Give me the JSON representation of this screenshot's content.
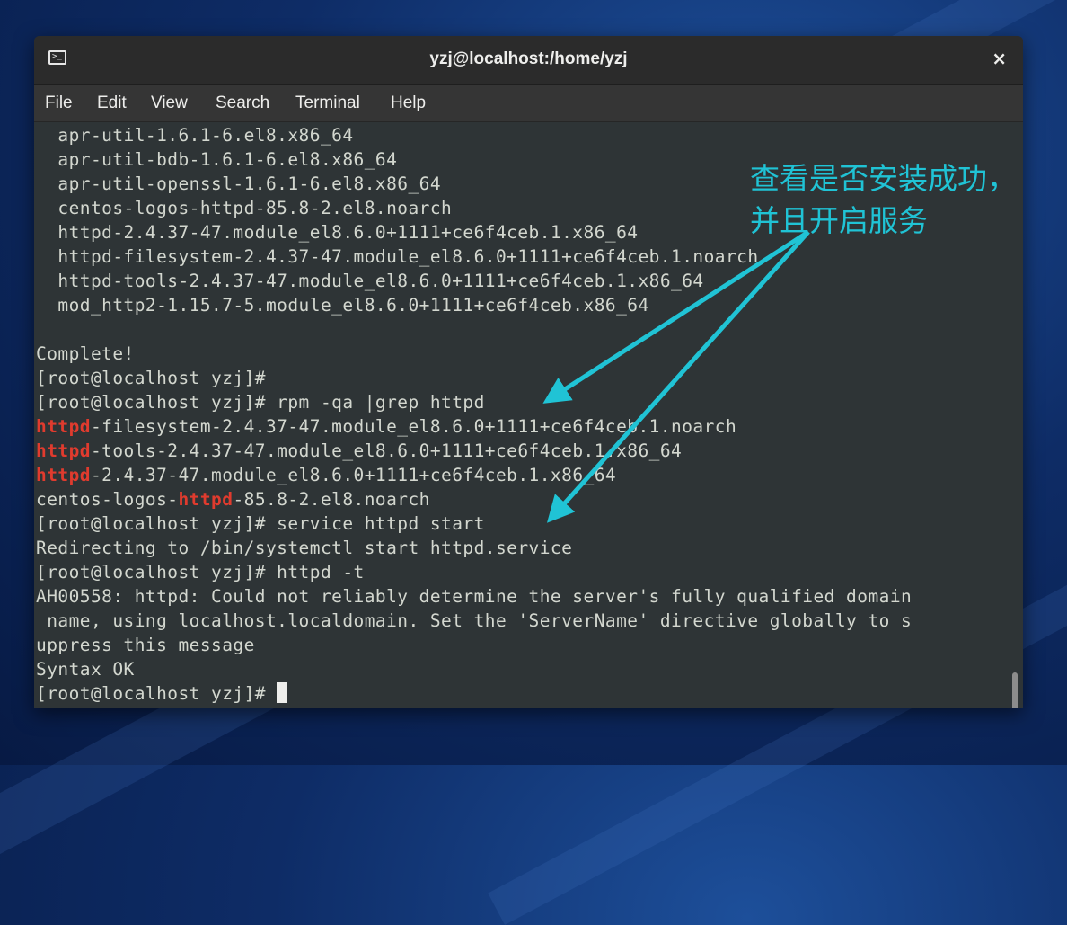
{
  "window": {
    "title": "yzj@localhost:/home/yzj",
    "close_glyph": "×",
    "icon": "terminal-icon"
  },
  "menu": [
    "File",
    "Edit",
    "View",
    "Search",
    "Terminal",
    "Help"
  ],
  "terminal": {
    "lines": [
      [
        {
          "t": "  apr-util-1.6.1-6.el8.x86_64"
        }
      ],
      [
        {
          "t": "  apr-util-bdb-1.6.1-6.el8.x86_64"
        }
      ],
      [
        {
          "t": "  apr-util-openssl-1.6.1-6.el8.x86_64"
        }
      ],
      [
        {
          "t": "  centos-logos-httpd-85.8-2.el8.noarch"
        }
      ],
      [
        {
          "t": "  httpd-2.4.37-47.module_el8.6.0+1111+ce6f4ceb.1.x86_64"
        }
      ],
      [
        {
          "t": "  httpd-filesystem-2.4.37-47.module_el8.6.0+1111+ce6f4ceb.1.noarch"
        }
      ],
      [
        {
          "t": "  httpd-tools-2.4.37-47.module_el8.6.0+1111+ce6f4ceb.1.x86_64"
        }
      ],
      [
        {
          "t": "  mod_http2-1.15.7-5.module_el8.6.0+1111+ce6f4ceb.x86_64"
        }
      ],
      [
        {
          "t": ""
        }
      ],
      [
        {
          "t": "Complete!"
        }
      ],
      [
        {
          "t": "[root@localhost yzj]#"
        }
      ],
      [
        {
          "t": "[root@localhost yzj]# rpm -qa |grep httpd"
        }
      ],
      [
        {
          "t": "httpd",
          "hl": true
        },
        {
          "t": "-filesystem-2.4.37-47.module_el8.6.0+1111+ce6f4ceb.1.noarch"
        }
      ],
      [
        {
          "t": "httpd",
          "hl": true
        },
        {
          "t": "-tools-2.4.37-47.module_el8.6.0+1111+ce6f4ceb.1.x86_64"
        }
      ],
      [
        {
          "t": "httpd",
          "hl": true
        },
        {
          "t": "-2.4.37-47.module_el8.6.0+1111+ce6f4ceb.1.x86_64"
        }
      ],
      [
        {
          "t": "centos-logos-"
        },
        {
          "t": "httpd",
          "hl": true
        },
        {
          "t": "-85.8-2.el8.noarch"
        }
      ],
      [
        {
          "t": "[root@localhost yzj]# service httpd start"
        }
      ],
      [
        {
          "t": "Redirecting to /bin/systemctl start httpd.service"
        }
      ],
      [
        {
          "t": "[root@localhost yzj]# httpd -t"
        }
      ],
      [
        {
          "t": "AH00558: httpd: Could not reliably determine the server's fully qualified domain"
        }
      ],
      [
        {
          "t": " name, using localhost.localdomain. Set the 'ServerName' directive globally to s"
        }
      ],
      [
        {
          "t": "uppress this message"
        }
      ],
      [
        {
          "t": "Syntax OK"
        }
      ],
      [
        {
          "t": "[root@localhost yzj]# "
        },
        {
          "cursor": true
        }
      ]
    ]
  },
  "annotation": {
    "text_line1": "查看是否安装成功，",
    "text_line2": "并且开启服务",
    "color": "#20c3d5"
  },
  "colors": {
    "terminal_bg": "#2e3436",
    "terminal_fg": "#d3d7cf",
    "match_highlight": "#e03b2e"
  }
}
